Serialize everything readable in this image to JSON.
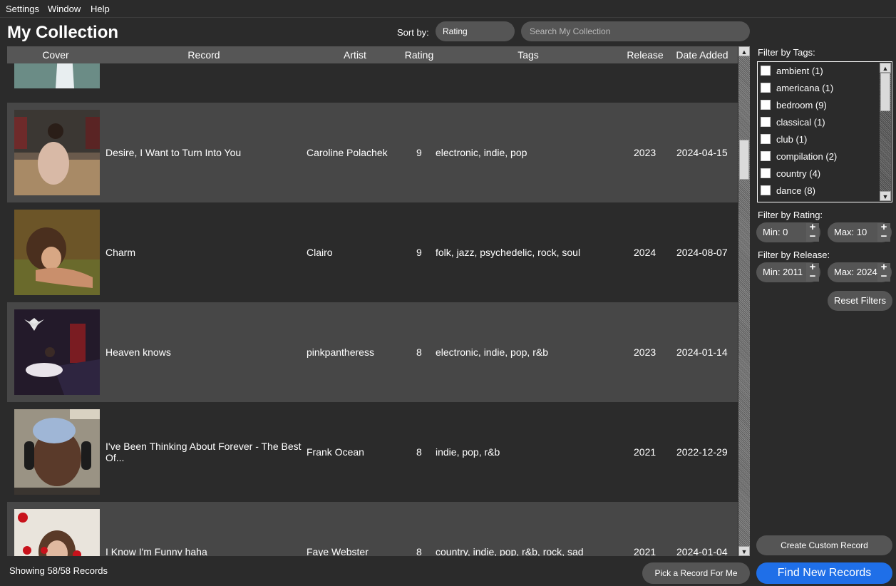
{
  "menu": [
    "Settings",
    "Window",
    "Help"
  ],
  "title": "My Collection",
  "sort": {
    "label": "Sort by:",
    "value": "Rating"
  },
  "search": {
    "placeholder": "Search My Collection"
  },
  "columns": [
    "Cover",
    "Record",
    "Artist",
    "Rating",
    "Tags",
    "Release",
    "Date Added"
  ],
  "rows": [
    {
      "record": "Desire, I Want to Turn Into You",
      "artist": "Caroline Polachek",
      "rating": "9",
      "tags": "electronic, indie, pop",
      "release": "2023",
      "date_added": "2024-04-15"
    },
    {
      "record": "Charm",
      "artist": "Clairo",
      "rating": "9",
      "tags": "folk, jazz, psychedelic, rock, soul",
      "release": "2024",
      "date_added": "2024-08-07"
    },
    {
      "record": "Heaven knows",
      "artist": "pinkpantheress",
      "rating": "8",
      "tags": "electronic, indie, pop, r&b",
      "release": "2023",
      "date_added": "2024-01-14"
    },
    {
      "record": "I've Been Thinking About Forever - The Best Of...",
      "artist": "Frank Ocean",
      "rating": "8",
      "tags": "indie, pop, r&b",
      "release": "2021",
      "date_added": "2022-12-29"
    },
    {
      "record": "I Know I'm Funny haha",
      "artist": "Faye Webster",
      "rating": "8",
      "tags": "country, indie, pop, r&b, rock, sad",
      "release": "2021",
      "date_added": "2024-01-04"
    }
  ],
  "status": "Showing 58/58 Records",
  "buttons": {
    "pick": "Pick a Record For Me",
    "create": "Create Custom Record",
    "find": "Find New Records",
    "reset": "Reset Filters"
  },
  "filters": {
    "tags_label": "Filter by Tags:",
    "tags": [
      "ambient (1)",
      "americana (1)",
      "bedroom (9)",
      "classical (1)",
      "club (1)",
      "compilation (2)",
      "country (4)",
      "dance (8)"
    ],
    "rating_label": "Filter by Rating:",
    "rating_min": "Min: 0",
    "rating_max": "Max: 10",
    "release_label": "Filter by Release:",
    "release_min": "Min: 2011",
    "release_max": "Max: 2024"
  },
  "colors": {
    "background": "#2b2b2b",
    "row_alt": "#474747",
    "header": "#565656",
    "control": "#555555",
    "accent": "#1f6fe8"
  },
  "icons": {
    "spin_up": "+",
    "spin_down": "−",
    "scroll_up": "▲",
    "scroll_down": "▼"
  }
}
